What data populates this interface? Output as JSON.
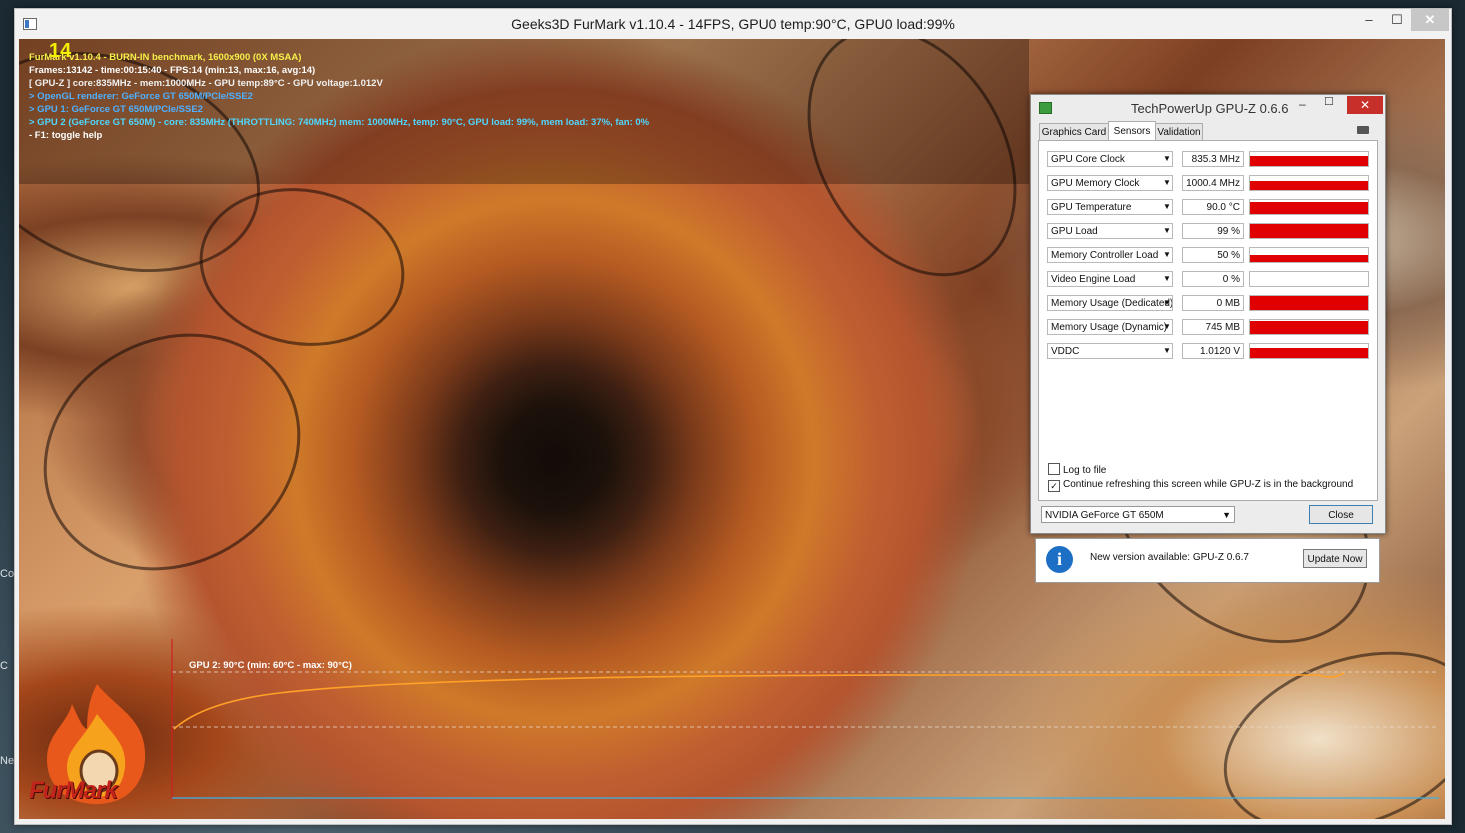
{
  "furmark": {
    "title": "Geeks3D FurMark v1.10.4 - 14FPS, GPU0 temp:90°C, GPU0 load:99%",
    "minimize_glyph": "–",
    "maximize_glyph": "☐",
    "close_glyph": "✕",
    "fps_overlay": "14",
    "hud_lines": [
      {
        "text": "FurMark v1.10.4 - BURN-IN benchmark, 1600x900 (0X MSAA)",
        "color": "#f6ef4a"
      },
      {
        "text": "Frames:13142 - time:00:15:40 - FPS:14 (min:13, max:16, avg:14)",
        "color": "#ffffff"
      },
      {
        "text": "[ GPU-Z ] core:835MHz - mem:1000MHz - GPU temp:89°C - GPU voltage:1.012V",
        "color": "#f0f0f0"
      },
      {
        "text": "> OpenGL renderer: GeForce GT 650M/PCIe/SSE2",
        "color": "#4fb0ff"
      },
      {
        "text": "> GPU 1: GeForce GT 650M/PCIe/SSE2",
        "color": "#4fb0ff"
      },
      {
        "text": "> GPU 2 (GeForce GT 650M) - core: 835MHz (THROTTLING: 740MHz) mem: 1000MHz, temp: 90°C, GPU load: 99%, mem load: 37%, fan: 0%",
        "color": "#4fd7ff"
      },
      {
        "text": "- F1: toggle help",
        "color": "#ffffff"
      }
    ],
    "graph_label": "GPU 2: 90°C (min: 60°C - max: 90°C)",
    "logo_text": "FurMark"
  },
  "desktop": {
    "side_labels": [
      "Co",
      "C",
      "Ne"
    ]
  },
  "gpuz": {
    "title": "TechPowerUp GPU-Z 0.6.6",
    "minimize_glyph": "–",
    "maximize_glyph": "☐",
    "close_glyph": "✕",
    "tabs": [
      {
        "label": "Graphics Card",
        "active": false
      },
      {
        "label": "Sensors",
        "active": true
      },
      {
        "label": "Validation",
        "active": false
      }
    ],
    "sensors": [
      {
        "name": "GPU Core Clock",
        "value": "835.3 MHz",
        "level": 0.75
      },
      {
        "name": "GPU Memory Clock",
        "value": "1000.4 MHz",
        "level": 0.65
      },
      {
        "name": "GPU Temperature",
        "value": "90.0 °C",
        "level": 0.85
      },
      {
        "name": "GPU Load",
        "value": "99 %",
        "level": 0.99
      },
      {
        "name": "Memory Controller Load",
        "value": "50 %",
        "level": 0.5
      },
      {
        "name": "Video Engine Load",
        "value": "0 %",
        "level": 0.0
      },
      {
        "name": "Memory Usage (Dedicated)",
        "value": "0 MB",
        "level": 1.0
      },
      {
        "name": "Memory Usage (Dynamic)",
        "value": "745 MB",
        "level": 0.9
      },
      {
        "name": "VDDC",
        "value": "1.0120 V",
        "level": 0.7
      }
    ],
    "dropdown_glyph": "▼",
    "log_to_file": {
      "label": "Log to file",
      "checked": false
    },
    "continue_refresh": {
      "label": "Continue refreshing this screen while GPU-Z is in the background",
      "checked": true
    },
    "check_glyph": "✓",
    "card_select": "NVIDIA GeForce GT 650M",
    "close_button": "Close",
    "update_message": "New version available: GPU-Z 0.6.7",
    "update_button": "Update Now",
    "info_glyph": "i"
  },
  "colors": {
    "sensor_red": "#e00000",
    "graph_orange": "#ffa028",
    "graph_blue": "#3fb0e8",
    "graph_red": "#d02020"
  }
}
